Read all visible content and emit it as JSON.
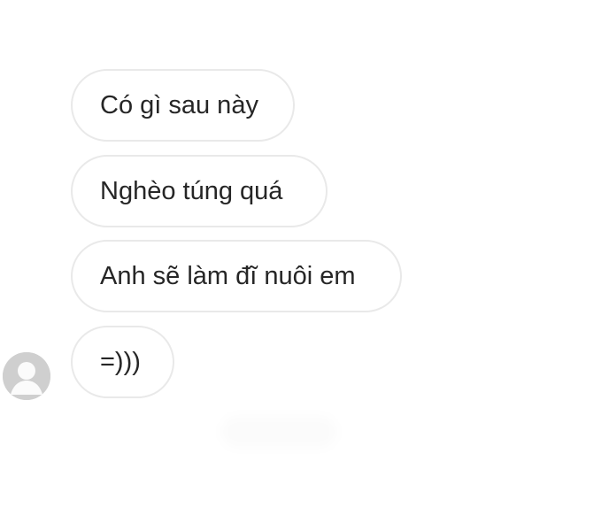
{
  "messages": [
    {
      "text": "Có gì sau này"
    },
    {
      "text": "Nghèo túng quá"
    },
    {
      "text": "Anh sẽ làm đĩ nuôi em"
    },
    {
      "text": "=)))"
    }
  ],
  "avatar": {
    "icon": "default-user-icon",
    "color": "#cfcfcf"
  },
  "colors": {
    "background": "#ffffff",
    "bubble_border": "#e9e9e9",
    "text": "#262626"
  }
}
